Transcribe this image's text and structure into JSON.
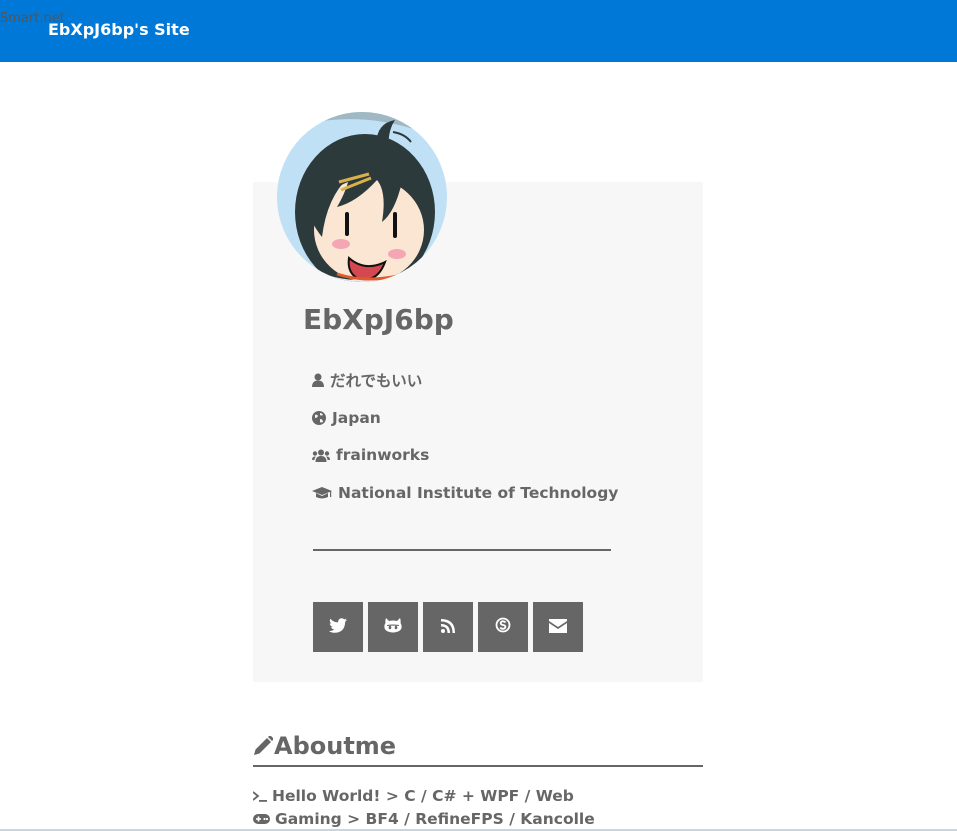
{
  "header": {
    "smart_label": "Smart.net",
    "site_title": "EbXpJ6bp's Site",
    "bar_color": "#0078d7"
  },
  "profile": {
    "username": "EbXpJ6bp",
    "info": [
      {
        "icon": "user-icon",
        "text": "だれでもいい"
      },
      {
        "icon": "globe-icon",
        "text": "Japan"
      },
      {
        "icon": "users-icon",
        "text": "frainworks"
      },
      {
        "icon": "graduation-cap-icon",
        "text": "National Institute of Technology"
      }
    ],
    "social": [
      {
        "icon": "twitter-icon"
      },
      {
        "icon": "github-icon"
      },
      {
        "icon": "rss-icon"
      },
      {
        "icon": "skype-icon"
      },
      {
        "icon": "envelope-icon"
      }
    ]
  },
  "about": {
    "heading": "Aboutme",
    "lines": [
      {
        "icon": "terminal-icon",
        "text": "Hello World! > C / C# + WPF / Web"
      },
      {
        "icon": "gamepad-icon",
        "text": "Gaming > BF4 / RefineFPS / Kancolle"
      }
    ]
  }
}
